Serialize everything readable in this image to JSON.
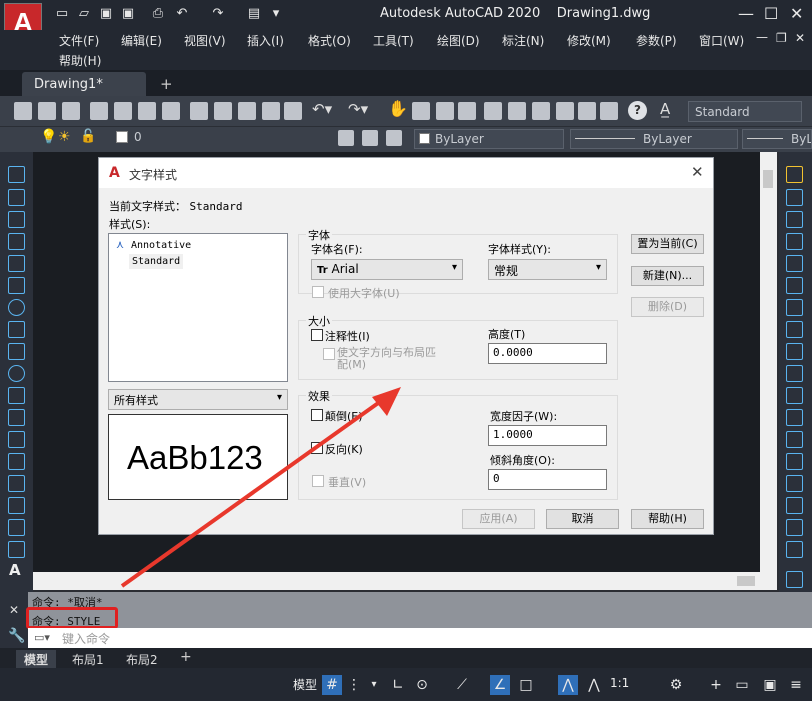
{
  "app": {
    "title": "Autodesk AutoCAD 2020",
    "document": "Drawing1.dwg",
    "app_letter": "A"
  },
  "menu": [
    "文件(F)",
    "编辑(E)",
    "视图(V)",
    "插入(I)",
    "格式(O)",
    "工具(T)",
    "绘图(D)",
    "标注(N)",
    "修改(M)",
    "参数(P)",
    "窗口(W)",
    "帮助(H)"
  ],
  "doc_tab": "Drawing1*",
  "toolbar": {
    "text_style": "Standard",
    "layer": "0",
    "color": "ByLayer",
    "linetype": "ByLayer",
    "lineweight": "ByLa"
  },
  "dialog": {
    "title": "文字样式",
    "current_style_label": "当前文字样式：",
    "current_style": "Standard",
    "styles_label": "样式(S):",
    "styles": [
      "Annotative",
      "Standard"
    ],
    "filter": "所有样式",
    "preview": "AaBb123",
    "font_group": "字体",
    "font_name_label": "字体名(F):",
    "font_name": "Arial",
    "font_style_label": "字体样式(Y):",
    "font_style": "常规",
    "use_bigfont": "使用大字体(U)",
    "size_group": "大小",
    "annotative": "注释性(I)",
    "match_orient": "使文字方向与布局匹配(M)",
    "height_label": "高度(T)",
    "height": "0.0000",
    "effects_group": "效果",
    "upside_down": "颠倒(E)",
    "backwards": "反向(K)",
    "vertical": "垂直(V)",
    "width_label": "宽度因子(W):",
    "width": "1.0000",
    "oblique_label": "倾斜角度(O):",
    "oblique": "0",
    "set_current": "置为当前(C)",
    "new": "新建(N)...",
    "delete": "删除(D)",
    "apply": "应用(A)",
    "cancel": "取消",
    "help": "帮助(H)"
  },
  "command": {
    "line1": "命令: *取消*",
    "line2": "命令: STYLE",
    "placeholder": "键入命令"
  },
  "layout_tabs": [
    "模型",
    "布局1",
    "布局2"
  ],
  "status": {
    "model": "模型",
    "scale": "1:1"
  },
  "colors": {
    "highlight_box": "#e02020",
    "arrow": "#e8382c",
    "accent": "#c8282b"
  }
}
